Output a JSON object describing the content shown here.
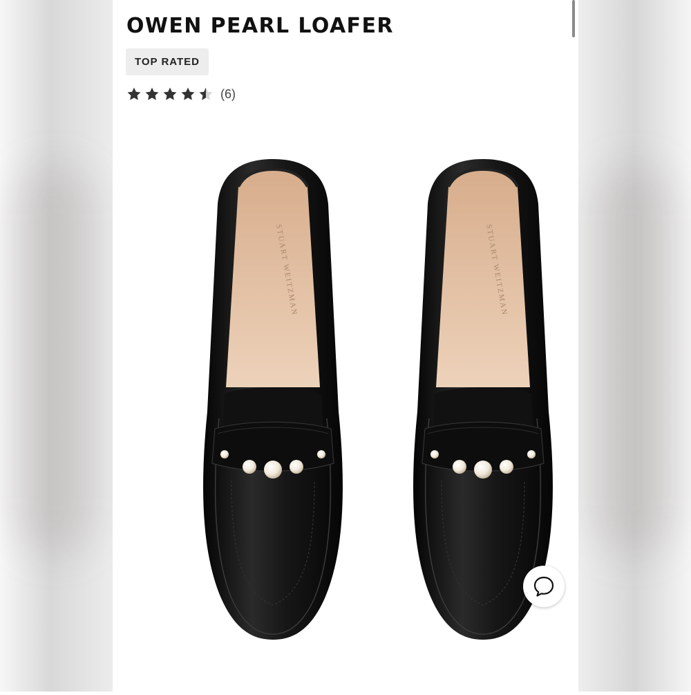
{
  "product": {
    "title": "OWEN PEARL LOAFER",
    "badge": "TOP RATED",
    "rating": 4.5,
    "review_count_label": "(6)",
    "insole_brand": "STUART WEITZMAN"
  },
  "icons": {
    "star": "star-icon",
    "chat": "chat-bubble-icon"
  },
  "colors": {
    "star_fill": "#333333",
    "leather": "#141414",
    "insole": "#e3bfa2",
    "pearl": "#f3ece0"
  }
}
